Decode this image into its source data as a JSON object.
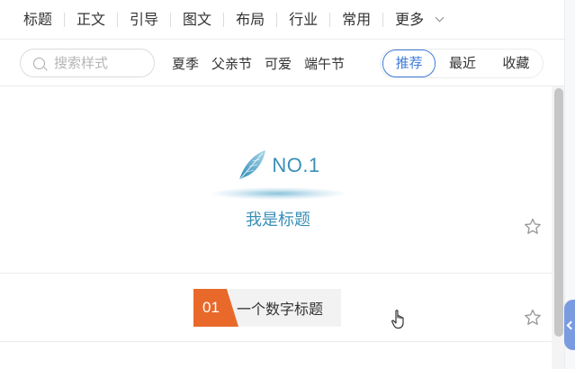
{
  "categories": [
    "标题",
    "正文",
    "引导",
    "图文",
    "布局",
    "行业",
    "常用"
  ],
  "more_label": "更多",
  "search": {
    "placeholder": "搜索样式",
    "value": ""
  },
  "tags": [
    "夏季",
    "父亲节",
    "可爱",
    "端午节"
  ],
  "segments": {
    "recommended": "推荐",
    "recent": "最近",
    "favorites": "收藏",
    "active": "推荐"
  },
  "styles": [
    {
      "badge": "NO.1",
      "title": "我是标题"
    },
    {
      "number": "01",
      "title": "一个数字标题"
    }
  ],
  "colors": {
    "accent": "#3e7bd8",
    "teal": "#3a8fb7",
    "orange": "#e8692a"
  }
}
